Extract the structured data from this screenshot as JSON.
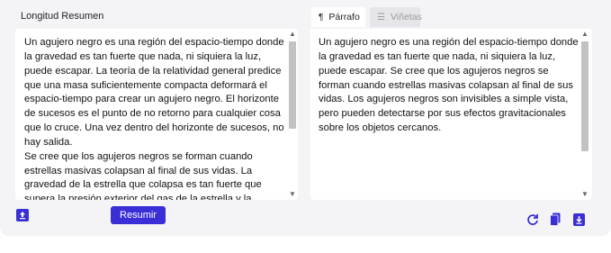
{
  "left_panel": {
    "length_label": "Longitud Resumen",
    "paragraphs": [
      "Un agujero negro es una región del espacio-tiempo donde la gravedad es tan fuerte que nada, ni siquiera la luz, puede escapar. La teoría de la relatividad general predice que una masa suficientemente compacta deformará el espacio-tiempo para crear un agujero negro. El horizonte de sucesos es el punto de no retorno para cualquier cosa que lo cruce. Una vez dentro del horizonte de sucesos, no hay salida.",
      "Se cree que los agujeros negros se forman cuando estrellas masivas colapsan al final de sus vidas. La gravedad de la estrella que colapsa es tan fuerte que supera la presión exterior del gas de la estrella y la estrella colapsa en un pequeño punto de densidad infinita. Este punto se llama singularidad."
    ],
    "summarize_label": "Resumir",
    "upload_icon": "upload-icon"
  },
  "right_panel": {
    "tabs": [
      {
        "label": "Párrafo",
        "icon": "pilcrow-icon",
        "active": true
      },
      {
        "label": "Viñetas",
        "icon": "list-icon",
        "active": false
      }
    ],
    "summary_text": "Un agujero negro es una región del espacio-tiempo donde la gravedad es tan fuerte que nada, ni siquiera la luz, puede escapar. Se cree que los agujeros negros se forman cuando estrellas masivas colapsan al final de sus vidas. Los agujeros negros son invisibles a simple vista, pero pueden detectarse por sus efectos gravitacionales sobre los objetos cercanos.",
    "actions": [
      "refresh-icon",
      "copy-icon",
      "download-icon"
    ]
  },
  "colors": {
    "accent": "#3a2fd6",
    "panel_bg": "#f4f4f7",
    "inactive_tab": "#e6e6ea"
  }
}
